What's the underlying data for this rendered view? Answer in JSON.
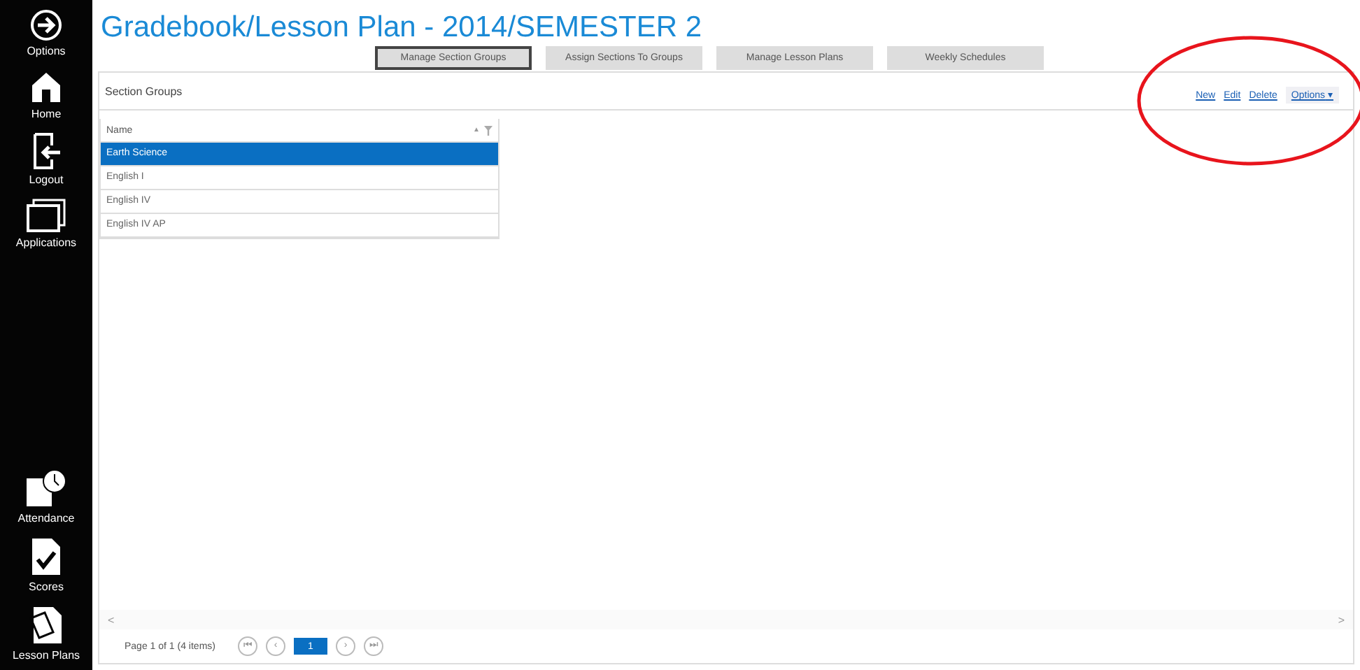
{
  "sidebar": {
    "top_items": [
      {
        "kind": "options",
        "label": "Options"
      },
      {
        "kind": "home",
        "label": "Home"
      },
      {
        "kind": "logout",
        "label": "Logout"
      },
      {
        "kind": "applications",
        "label": "Applications"
      }
    ],
    "bottom_items": [
      {
        "kind": "attendance",
        "label": "Attendance"
      },
      {
        "kind": "scores",
        "label": "Scores"
      },
      {
        "kind": "lesson",
        "label": "Lesson Plans"
      }
    ]
  },
  "title": "Gradebook/Lesson Plan - 2014/SEMESTER 2",
  "tabs": [
    {
      "label": "Manage Section Groups",
      "selected": true
    },
    {
      "label": "Assign Sections To Groups",
      "selected": false
    },
    {
      "label": "Manage Lesson Plans",
      "selected": false
    },
    {
      "label": "Weekly Schedules",
      "selected": false
    }
  ],
  "panel": {
    "title": "Section Groups",
    "links": [
      "New",
      "Edit",
      "Delete"
    ],
    "options_menu": "Options",
    "options_caret": "▾",
    "circled": true
  },
  "grid": {
    "column": "Name",
    "sort_mark": "▲",
    "rows": [
      {
        "name": "Earth Science",
        "selected": true
      },
      {
        "name": "English I",
        "selected": false
      },
      {
        "name": "English IV",
        "selected": false
      },
      {
        "name": "English IV AP",
        "selected": false
      }
    ]
  },
  "scroll": {
    "left": "<",
    "right": ">"
  },
  "pager": {
    "info": "Page 1 of 1 (4 items)",
    "first": "⏮",
    "prev": "‹",
    "pages": [
      {
        "label": "1",
        "selected": true
      }
    ],
    "next": "›",
    "last": "⏭"
  }
}
